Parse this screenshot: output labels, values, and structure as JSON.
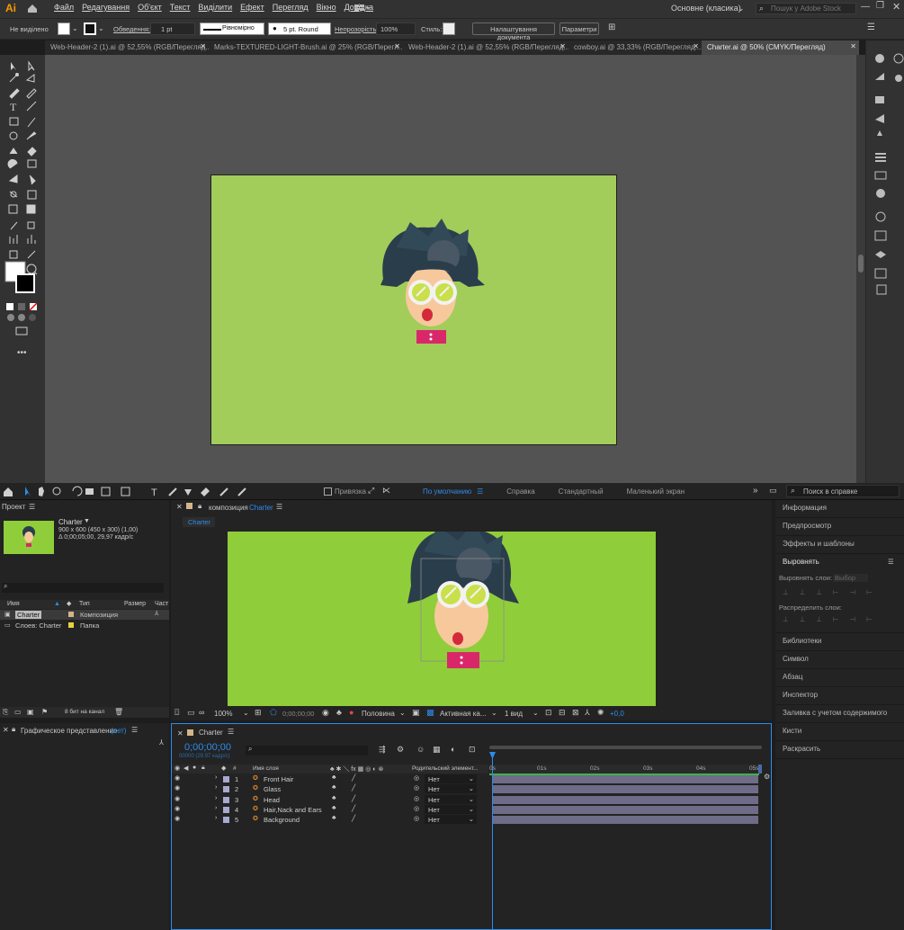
{
  "ai": {
    "logo": "Ai",
    "menu": [
      "Файл",
      "Редагування",
      "Об'єкт",
      "Текст",
      "Виділити",
      "Ефект",
      "Перегляд",
      "Вікно",
      "Довідка"
    ],
    "workspace": "Основне (класика)",
    "stock_placeholder": "Пошук у Adobe Stock",
    "control": {
      "selection": "Не виділено",
      "stroke_label": "Обведення:",
      "stroke_weight": "1 pt",
      "profile": "Рівномірно",
      "brush": "5 pt. Round",
      "opacity_label": "Непрозорість:",
      "opacity": "100%",
      "style_label": "Стиль:",
      "doc_setup": "Налаштування документа",
      "prefs": "Параметри"
    },
    "tabs": [
      "Web-Header-2 (1).ai @ 52,55% (RGB/Перегляд...",
      "Marks-TEXTURED-LIGHT-Brush.ai @ 25% (RGB/Перегл...",
      "Web-Header-2 (1).ai @ 52,55% (RGB/Перегляд...",
      "cowboy.ai @ 33,33% (RGB/Перегляд...",
      "Charter.ai @ 50% (CMYK/Перегляд)"
    ]
  },
  "ae": {
    "workspaces": [
      "По умолчанию",
      "Справка",
      "Стандартный",
      "Маленький экран"
    ],
    "snap": "Привязка",
    "help_search": "Поиск в справке",
    "project": {
      "title": "Проект",
      "comp_name": "Charter",
      "comp_info1": "900 x 600 (450 x 300) (1,00)",
      "comp_info2": "Δ 0;00;05;00, 29,97 кадр/с",
      "cols": [
        "Имя",
        "Тип",
        "Размер",
        "Част"
      ],
      "items": [
        {
          "name": "Charter",
          "type": "Композиция"
        },
        {
          "name": "Слоев: Charter",
          "type": "Папка"
        }
      ],
      "bpc": "8 бит на канал"
    },
    "flow": {
      "title": "Графическое представление",
      "none": "(нет)"
    },
    "comp_panel": {
      "label": "композиция",
      "name": "Charter",
      "tab": "Charter",
      "zoom": "100%",
      "time": "0;00;00;00",
      "res": "Половина",
      "cam": "Активная ка...",
      "view": "1 вид",
      "exposure": "+0,0"
    },
    "right": {
      "items": [
        "Информация",
        "Предпросмотр",
        "Эффекты и шаблоны",
        "Выровнять",
        "Библиотеки",
        "Символ",
        "Абзац",
        "Инспектор",
        "Заливка с учетом содержимого",
        "Кисти",
        "Раскрасить"
      ],
      "align_layers": "Выровнять слои:",
      "selection": "Выбор",
      "distribute": "Распределить слои:"
    },
    "timeline": {
      "tab": "Charter",
      "time": "0;00;00;00",
      "fps": "00000 (29.97 кадр/с)",
      "cols": {
        "num": "#",
        "name": "Имя слоя",
        "parent": "Родительский элемент..."
      },
      "ticks": [
        "0s",
        "01s",
        "02s",
        "03s",
        "04s",
        "05s"
      ],
      "layers": [
        {
          "n": "1",
          "name": "Front Hair",
          "parent": "Нет"
        },
        {
          "n": "2",
          "name": "Glass",
          "parent": "Нет"
        },
        {
          "n": "3",
          "name": "Head",
          "parent": "Нет"
        },
        {
          "n": "4",
          "name": "Hair,Nack and Ears",
          "parent": "Нет"
        },
        {
          "n": "5",
          "name": "Background",
          "parent": "Нет"
        }
      ]
    }
  },
  "colors": {
    "artboard": "#a2cd5a",
    "comp_bg": "#8fce3a",
    "accent": "#2d8ceb",
    "ai_orange": "#ff9a00"
  }
}
